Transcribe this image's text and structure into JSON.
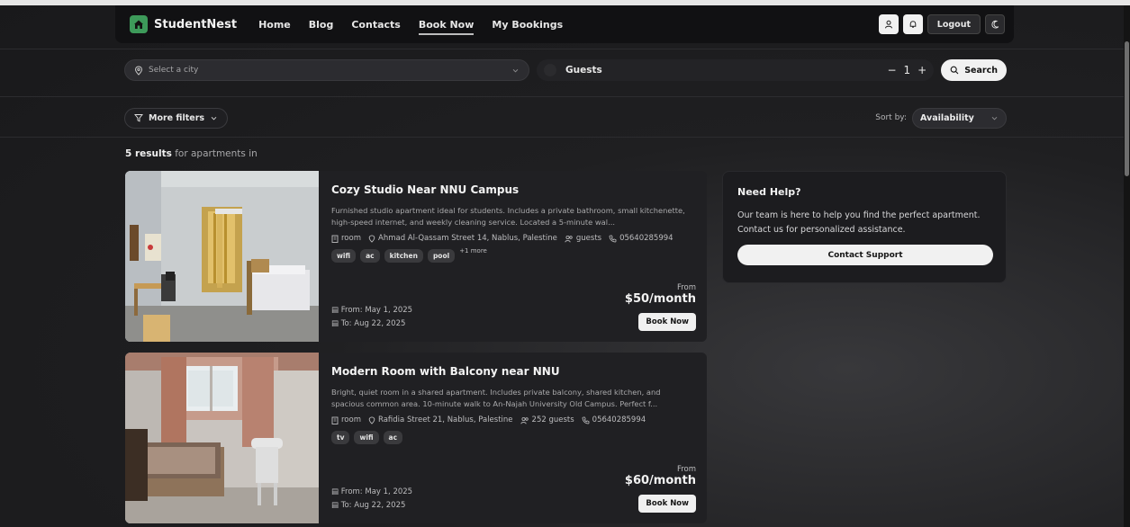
{
  "brand": {
    "name": "StudentNest",
    "logo_icon": "house-icon",
    "accent": "#3d9a5a"
  },
  "nav": {
    "links": [
      {
        "label": "Home",
        "active": false
      },
      {
        "label": "Blog",
        "active": false
      },
      {
        "label": "Contacts",
        "active": false
      },
      {
        "label": "Book Now",
        "active": true
      },
      {
        "label": "My Bookings",
        "active": false
      }
    ],
    "logout_label": "Logout",
    "icons": [
      "user-icon",
      "bell-icon",
      "moon-icon"
    ]
  },
  "search": {
    "city_placeholder": "Select a city",
    "guests_label": "Guests",
    "guests_minus": "−",
    "guests_value": "1",
    "guests_plus": "+",
    "search_label": "Search"
  },
  "filters": {
    "more_filters_label": "More filters",
    "sort_label": "Sort by:",
    "sort_value": "Availability"
  },
  "results": {
    "count": "5 results",
    "suffix": "for apartments in"
  },
  "listings": [
    {
      "title": "Cozy Studio Near NNU Campus",
      "description": "Furnished studio apartment ideal for students. Includes a private bathroom, small kitchenette, high-speed internet, and weekly cleaning service. Located a 5-minute wal...",
      "type": "room",
      "address": "Ahmad Al-Qassam Street 14, Nablus, Palestine",
      "guests": "guests",
      "phone": "05640285994",
      "tags": [
        "wifi",
        "ac",
        "kitchen",
        "pool"
      ],
      "more_tags": "+1 more",
      "from_date": "From: May 1, 2025",
      "to_date": "To: Aug 22, 2025",
      "price_prefix": "From",
      "price": "$50/month",
      "book_label": "Book Now"
    },
    {
      "title": "Modern Room with Balcony near NNU",
      "description": "Bright, quiet room in a shared apartment. Includes private balcony, shared kitchen, and spacious common area. 10-minute walk to An-Najah University Old Campus. Perfect f...",
      "type": "room",
      "address": "Rafidia Street 21, Nablus, Palestine",
      "guests": "252 guests",
      "phone": "05640285994",
      "tags": [
        "tv",
        "wifi",
        "ac"
      ],
      "more_tags": "",
      "from_date": "From: May 1, 2025",
      "to_date": "To: Aug 22, 2025",
      "price_prefix": "From",
      "price": "$60/month",
      "book_label": "Book Now"
    }
  ],
  "help": {
    "title": "Need Help?",
    "text": "Our team is here to help you find the perfect apartment. Contact us for personalized assistance.",
    "button_label": "Contact Support"
  }
}
